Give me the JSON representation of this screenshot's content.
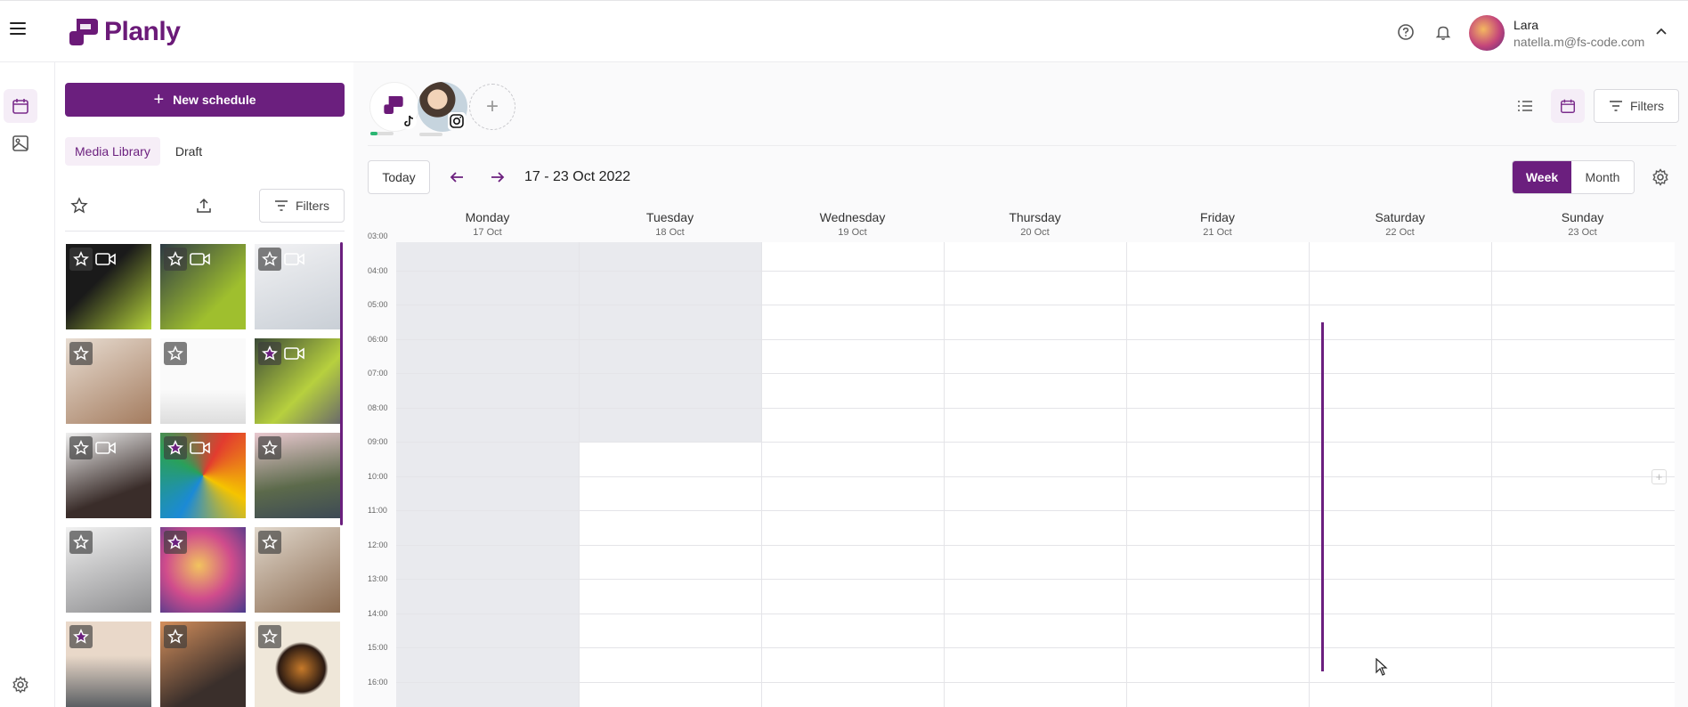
{
  "app": {
    "name": "Planly",
    "brand_color": "#6b1f7e"
  },
  "user": {
    "name": "Lara",
    "email": "natella.m@fs-code.com"
  },
  "topbar_icons": [
    "help-icon",
    "bell-icon",
    "chevron-up-icon"
  ],
  "rail": {
    "items": [
      "calendar-icon",
      "image-icon",
      "settings-icon"
    ]
  },
  "sidebar": {
    "new_schedule_label": "New schedule",
    "tabs": [
      "Media Library",
      "Draft"
    ],
    "filters_label": "Filters",
    "media": [
      {
        "starred": false,
        "video": true
      },
      {
        "starred": false,
        "video": true
      },
      {
        "starred": false,
        "video": true
      },
      {
        "starred": false,
        "video": false
      },
      {
        "starred": false,
        "video": false
      },
      {
        "starred": true,
        "video": true
      },
      {
        "starred": false,
        "video": true
      },
      {
        "starred": true,
        "video": true
      },
      {
        "starred": false,
        "video": false
      },
      {
        "starred": false,
        "video": false
      },
      {
        "starred": true,
        "video": false
      },
      {
        "starred": false,
        "video": false
      },
      {
        "starred": true,
        "video": false
      },
      {
        "starred": false,
        "video": false
      },
      {
        "starred": false,
        "video": false
      }
    ]
  },
  "toolbar": {
    "filters_label": "Filters",
    "today_label": "Today",
    "date_range": "17 - 23 Oct 2022",
    "week_label": "Week",
    "month_label": "Month"
  },
  "calendar": {
    "days": [
      {
        "name": "Monday",
        "date": "17 Oct"
      },
      {
        "name": "Tuesday",
        "date": "18 Oct"
      },
      {
        "name": "Wednesday",
        "date": "19 Oct"
      },
      {
        "name": "Thursday",
        "date": "20 Oct"
      },
      {
        "name": "Friday",
        "date": "21 Oct"
      },
      {
        "name": "Saturday",
        "date": "22 Oct"
      },
      {
        "name": "Sunday",
        "date": "23 Oct"
      }
    ],
    "times": [
      "03:00",
      "04:00",
      "05:00",
      "06:00",
      "07:00",
      "08:00",
      "09:00",
      "10:00",
      "11:00",
      "12:00",
      "13:00",
      "14:00",
      "15:00",
      "16:00"
    ]
  }
}
